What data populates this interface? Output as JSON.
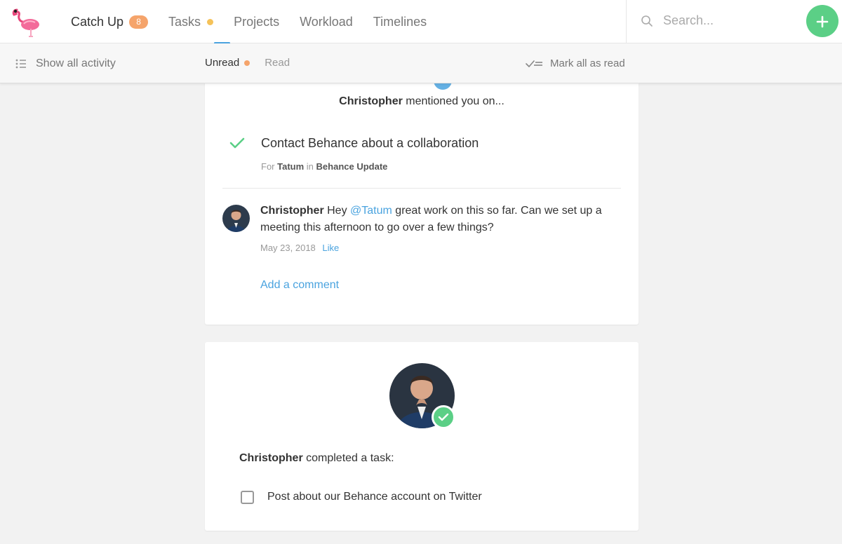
{
  "nav": {
    "items": [
      {
        "label": "Catch Up",
        "badge": "8",
        "active": true
      },
      {
        "label": "Tasks",
        "dot": true
      },
      {
        "label": "Projects"
      },
      {
        "label": "Workload"
      },
      {
        "label": "Timelines"
      }
    ],
    "search_placeholder": "Search..."
  },
  "subbar": {
    "show_all": "Show all activity",
    "tab_unread": "Unread",
    "tab_read": "Read",
    "mark_all": "Mark all as read"
  },
  "card1": {
    "actor": "Christopher",
    "action": "mentioned you on...",
    "task_title": "Contact Behance about a collaboration",
    "meta_for": "For",
    "meta_person": "Tatum",
    "meta_in": "in",
    "meta_project": "Behance Update",
    "comment_author": "Christopher",
    "comment_pre": "Hey",
    "comment_mention": "@Tatum",
    "comment_post": "great work on this so far. Can we set up a meeting this afternoon to go over a few things?",
    "comment_date": "May 23, 2018",
    "like_label": "Like",
    "add_comment": "Add a comment"
  },
  "card2": {
    "actor": "Christopher",
    "action": "completed a task:",
    "task_title": "Post about our Behance account on Twitter"
  },
  "colors": {
    "accent_blue": "#4aa3df",
    "green": "#5bcf86",
    "badge_orange": "#f5a46b",
    "dot_yellow": "#f5c259"
  }
}
